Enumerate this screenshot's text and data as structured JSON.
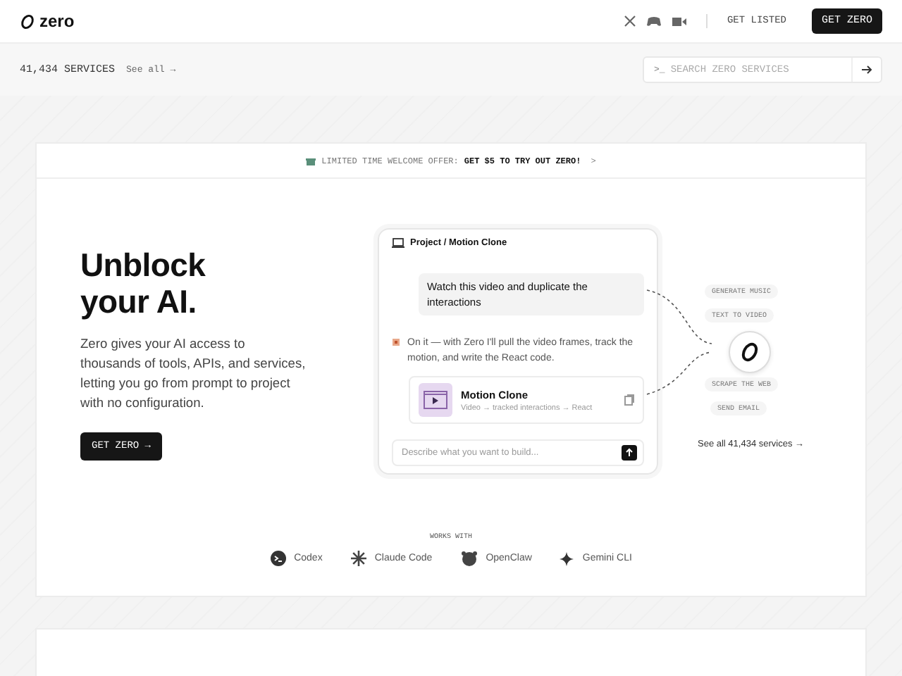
{
  "header": {
    "logo": "zero",
    "links": [
      "GET LISTED"
    ],
    "cta": "GET ZERO"
  },
  "subbar": {
    "count": "41,434 SERVICES",
    "see_all": "See all →",
    "search": {
      "prompt": ">_",
      "placeholder": "SEARCH ZERO SERVICES"
    }
  },
  "offer": {
    "label": "LIMITED TIME WELCOME OFFER:",
    "highlight": "GET $5 TO TRY OUT ZERO!",
    "chevron": ">"
  },
  "hero": {
    "title": "Unblock your AI.",
    "text": "Zero gives your AI access to thousands of tools, APIs, and services, letting you go from prompt to project with no configuration.",
    "button": "GET ZERO →"
  },
  "demo": {
    "title": "Project / Motion Clone",
    "user_message": "Watch this video and duplicate the interactions",
    "reply": "On it — with Zero I'll pull the video frames, track the motion, and write the React code.",
    "result": {
      "name": "Motion Clone",
      "detail": "Video → tracked interactions → React"
    },
    "input": {
      "placeholder": "Describe what you want to build..."
    }
  },
  "services": [
    {
      "label": "GENERATE MUSIC"
    },
    {
      "label": "TEXT TO VIDEO"
    },
    {
      "label": "SCRAPE THE WEB"
    },
    {
      "label": "SEND EMAIL"
    }
  ],
  "services_link": "See all 41,434 services →",
  "works_with": {
    "title": "WORKS WITH",
    "tools": [
      {
        "kind": "codex",
        "name": "Codex"
      },
      {
        "kind": "claude",
        "name": "Claude Code"
      },
      {
        "kind": "openclaw",
        "name": "OpenClaw"
      },
      {
        "kind": "gemini",
        "name": "Gemini CLI"
      }
    ]
  }
}
